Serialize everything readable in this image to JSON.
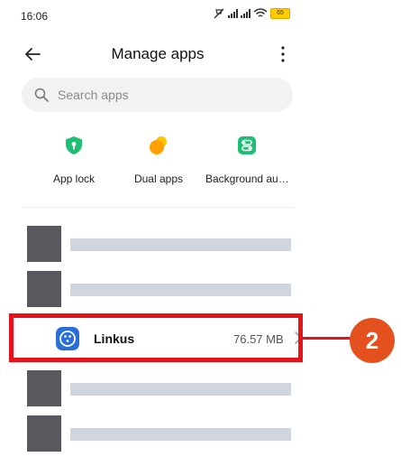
{
  "status_bar": {
    "time": "16:06",
    "battery": "65"
  },
  "header": {
    "title": "Manage apps"
  },
  "search": {
    "placeholder": "Search apps"
  },
  "shortcuts": [
    {
      "label": "App lock",
      "icon": "shield-lock-icon"
    },
    {
      "label": "Dual apps",
      "icon": "dual-apps-icon"
    },
    {
      "label": "Background au…",
      "icon": "background-autostart-icon"
    }
  ],
  "apps": {
    "featured": {
      "name": "Linkus",
      "size": "76.57 MB",
      "icon": "linkus-app-icon"
    }
  },
  "annotation": {
    "step": "2"
  },
  "colors": {
    "accent_green": "#1fbe74",
    "accent_orange": "#ffa200",
    "highlight_red": "#e8121a",
    "badge_orange": "#e4501e",
    "linkus_blue": "#2a6fd9"
  }
}
